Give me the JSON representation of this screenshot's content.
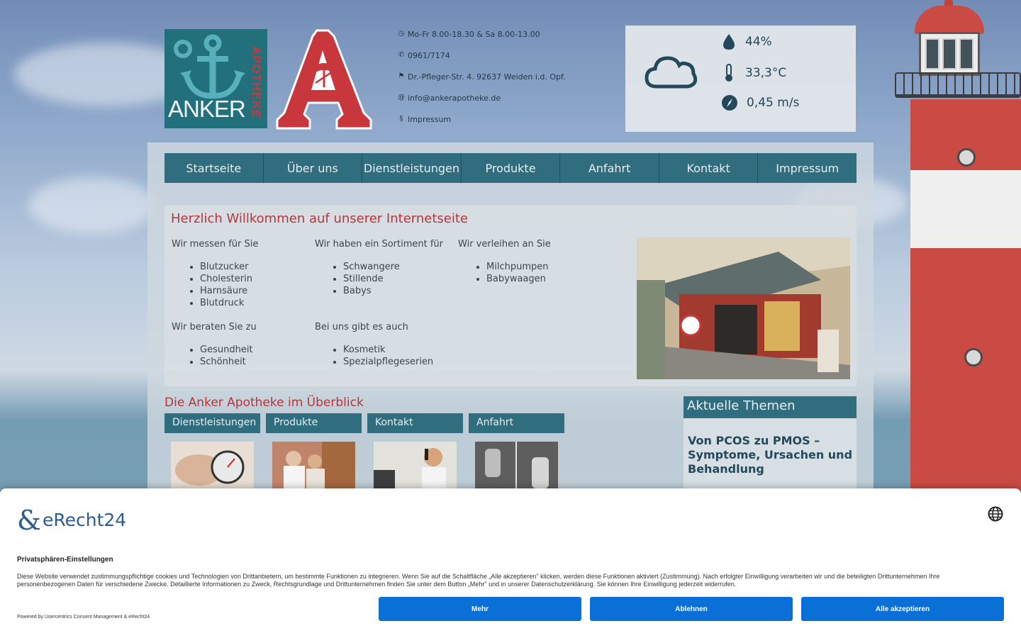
{
  "header": {
    "logo_word": "ANKER",
    "logo_vertical": "APOTHEKE",
    "contact": [
      {
        "icon": "clock-icon",
        "text": "Mo-Fr 8.00-18.30 & Sa 8.00-13.00"
      },
      {
        "icon": "phone-icon",
        "text": "0961/7174"
      },
      {
        "icon": "signpost-icon",
        "text": "Dr.-Pfleger-Str. 4. 92637 Weiden i.d. Opf."
      },
      {
        "icon": "at-icon",
        "text": "info@ankerapotheke.de"
      },
      {
        "icon": "paragraph-icon",
        "text": "Impressum"
      }
    ]
  },
  "weather": {
    "humidity": "44%",
    "temperature": "33,3°C",
    "wind": "0,45 m/s"
  },
  "nav": [
    "Startseite",
    "Über uns",
    "Dienstleistungen",
    "Produkte",
    "Anfahrt",
    "Kontakt",
    "Impressum"
  ],
  "welcome": {
    "title": "Herzlich Willkommen auf unserer Internetseite",
    "measure": {
      "heading": "Wir messen für Sie",
      "items": [
        "Blutzucker",
        "Cholesterin",
        "Harnsäure",
        "Blutdruck"
      ]
    },
    "assortment": {
      "heading": "Wir haben ein Sortiment für",
      "items": [
        "Schwangere",
        "Stillende",
        "Babys"
      ]
    },
    "rent": {
      "heading": "Wir verleihen an Sie",
      "items": [
        "Milchpumpen",
        "Babywaagen"
      ]
    },
    "advise": {
      "heading": "Wir beraten Sie zu",
      "items": [
        "Gesundheit",
        "Schönheit"
      ]
    },
    "also": {
      "heading": "Bei uns gibt es auch",
      "items": [
        "Kosmetik",
        "Spezialpflegeserien"
      ]
    }
  },
  "overview": {
    "title": "Die Anker Apotheke im Überblick",
    "tiles": [
      "Dienstleistungen",
      "Produkte",
      "Kontakt",
      "Anfahrt"
    ]
  },
  "themen": {
    "title": "Aktuelle Themen",
    "article_title": "Von PCOS zu PMOS – Symptome, Ursachen und Behandlung"
  },
  "consent": {
    "brand": "eRecht24",
    "title": "Privatsphären-Einstellungen",
    "text": "Diese Website verwendet zustimmungspflichtige cookies und Technologien von Drittanbietern, um bestimmte Funktionen zu integrieren. Wenn Sie auf die Schaltfläche „Alle akzeptieren\" klicken, werden diese Funktionen aktiviert (Zustimmung). Nach erfolgter Einwilligung verarbeiten wir und die beteiligten Drittunternehmen Ihre personenbezogenen Daten für verschiedene Zwecke. Detaillierte Informationen zu Zweck, Rechtsgrundlage und Drittunternehmen finden Sie unter dem Button „Mehr\" und in unserer Datenschutzerklärung. Sie können Ihre Einwilligung jederzeit widerrufen.",
    "powered": "Powered by Usercentrics Consent Management & eRecht24",
    "btn_more": "Mehr",
    "btn_decline": "Ablehnen",
    "btn_accept": "Alle akzeptieren"
  },
  "colors": {
    "teal": "#2f6d7f",
    "red": "#b8343a",
    "consent_blue": "#0a6fd6"
  }
}
